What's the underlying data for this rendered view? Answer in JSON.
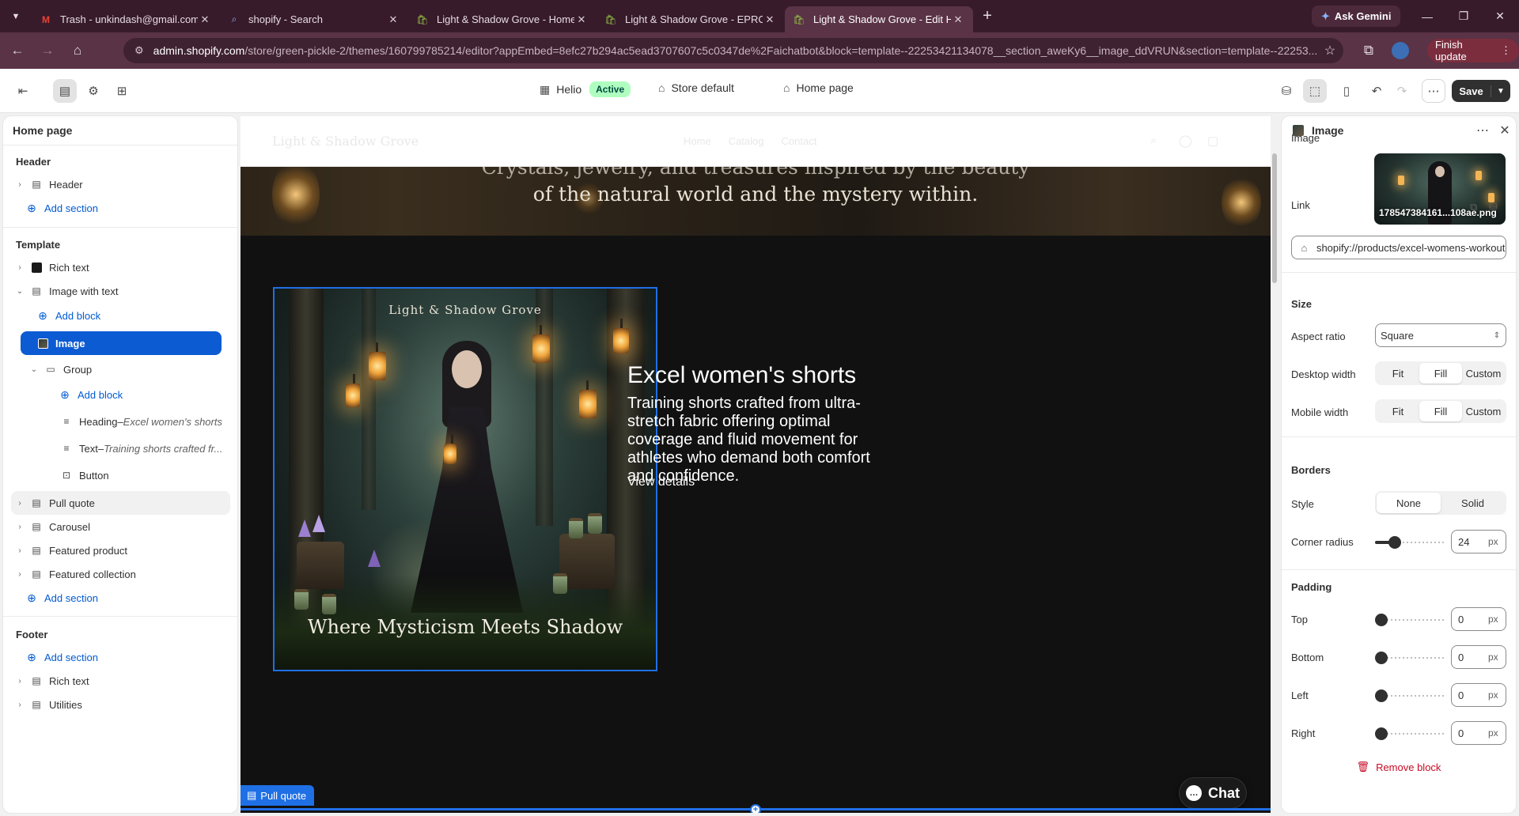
{
  "browser": {
    "tabs": [
      {
        "title": "Trash - unkindash@gmail.com",
        "icon": "gmail-icon",
        "active": false
      },
      {
        "title": "shopify - Search",
        "icon": "search-icon",
        "active": false
      },
      {
        "title": "Light & Shadow Grove - Home",
        "icon": "shopify-icon",
        "active": false
      },
      {
        "title": "Light & Shadow Grove - EPROL",
        "icon": "shopify-icon",
        "active": false
      },
      {
        "title": "Light & Shadow Grove - Edit He",
        "icon": "shopify-icon",
        "active": true
      }
    ],
    "ask_gemini": "Ask Gemini",
    "url_host": "admin.shopify.com",
    "url_path": "/store/green-pickle-2/themes/160799785214/editor?appEmbed=8efc27b294ac5ead3707607c5c0347de%2Faichatbot&block=template--22253421134078__section_aweKy6__image_ddVRUN&section=template--22253...",
    "finish_update": "Finish update"
  },
  "topbar": {
    "theme_name": "Helio",
    "theme_status": "Active",
    "store_default": "Store default",
    "page": "Home page",
    "save": "Save"
  },
  "left_panel": {
    "title": "Home page",
    "header_group": "Header",
    "header_item": "Header",
    "add_section": "Add section",
    "template_group": "Template",
    "rich_text": "Rich text",
    "image_with_text": "Image with text",
    "add_block": "Add block",
    "image": "Image",
    "group": "Group",
    "heading_label": "Heading",
    "heading_value": "Excel women's shorts",
    "text_label": "Text",
    "text_value": "Training shorts crafted fr...",
    "button": "Button",
    "pull_quote": "Pull quote",
    "carousel": "Carousel",
    "featured_product": "Featured product",
    "featured_collection": "Featured collection",
    "footer_group": "Footer",
    "footer_rich_text": "Rich text",
    "utilities": "Utilities",
    "separator": " – "
  },
  "canvas": {
    "banner_line1": "Crystals, jewelry, and treasures inspired by the beauty",
    "banner_line2": "of the natural world and the mystery within.",
    "image_top_text": "Light & Shadow Grove",
    "image_bottom_text": "Where Mysticism Meets Shadow",
    "heading": "Excel women's shorts",
    "text": "Training shorts crafted from ultra-stretch fabric offering optimal coverage and fluid movement for athletes who demand both comfort and confidence.",
    "button": "View details",
    "chat": "Chat",
    "pull_quote_tag": "Pull quote"
  },
  "right_panel": {
    "title": "Image",
    "image_label": "Image",
    "image_filename": "178547384161...108ae.png",
    "link_label": "Link",
    "link_value": "shopify://products/excel-womens-workout-shorts",
    "size_section": "Size",
    "aspect_ratio_label": "Aspect ratio",
    "aspect_ratio_value": "Square",
    "desktop_width_label": "Desktop width",
    "mobile_width_label": "Mobile width",
    "width_options": [
      "Fit",
      "Fill",
      "Custom"
    ],
    "width_selected": "Fill",
    "borders_section": "Borders",
    "style_label": "Style",
    "style_options": [
      "None",
      "Solid"
    ],
    "style_selected": "None",
    "corner_radius_label": "Corner radius",
    "corner_radius_value": "24",
    "corner_radius_fraction": 0.24,
    "unit": "px",
    "padding_section": "Padding",
    "padding": [
      {
        "label": "Top",
        "value": "0"
      },
      {
        "label": "Bottom",
        "value": "0"
      },
      {
        "label": "Left",
        "value": "0"
      },
      {
        "label": "Right",
        "value": "0"
      }
    ],
    "remove_block": "Remove block"
  },
  "colors": {
    "accent": "#005bd3",
    "selected_row": "#0c5bd3",
    "active_badge": "#affebf",
    "danger": "#c70a24",
    "browser_tabbar": "#371b2a"
  }
}
